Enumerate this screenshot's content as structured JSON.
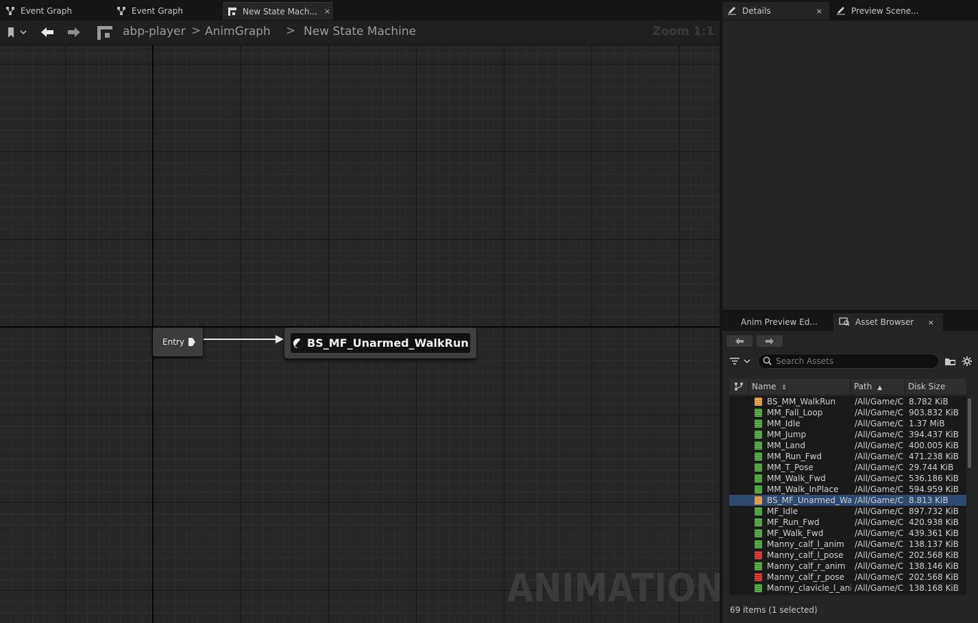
{
  "doc_tabs": [
    {
      "label": "Event Graph",
      "icon": "graph-icon"
    },
    {
      "label": "Event Graph",
      "icon": "graph-icon"
    },
    {
      "label": "New State Mach...",
      "icon": "state-machine-icon",
      "active": true,
      "close": "×"
    }
  ],
  "toolbar": {
    "breadcrumb": [
      "abp-player",
      "AnimGraph",
      "New State Machine"
    ],
    "separators": [
      ">",
      ">"
    ],
    "zoom": "Zoom 1:1"
  },
  "graph": {
    "entry_label": "Entry",
    "state_label": "BS_MF_Unarmed_WalkRun",
    "watermark": "ANIMATION"
  },
  "right_tabs": {
    "details": "Details",
    "details_close": "×",
    "preview_scene": "Preview Scene...",
    "anim_preview": "Anim Preview Ed...",
    "asset_browser": "Asset Browser",
    "asset_browser_close": "×"
  },
  "asset_browser": {
    "search_placeholder": "Search Assets",
    "columns": {
      "name": "Name",
      "path": "Path",
      "size": "Disk Size"
    },
    "rows": [
      {
        "name": "BS_MM_WalkRun",
        "path": "/All/Game/C",
        "size": "8.782 KiB",
        "type": "orange"
      },
      {
        "name": "MM_Fall_Loop",
        "path": "/All/Game/C",
        "size": "903.832 KiB",
        "type": "green"
      },
      {
        "name": "MM_Idle",
        "path": "/All/Game/C",
        "size": "1.37 MiB",
        "type": "green"
      },
      {
        "name": "MM_Jump",
        "path": "/All/Game/C",
        "size": "394.437 KiB",
        "type": "green"
      },
      {
        "name": "MM_Land",
        "path": "/All/Game/C",
        "size": "400.005 KiB",
        "type": "green"
      },
      {
        "name": "MM_Run_Fwd",
        "path": "/All/Game/C",
        "size": "471.238 KiB",
        "type": "green"
      },
      {
        "name": "MM_T_Pose",
        "path": "/All/Game/C",
        "size": "29.744 KiB",
        "type": "green"
      },
      {
        "name": "MM_Walk_Fwd",
        "path": "/All/Game/C",
        "size": "536.186 KiB",
        "type": "green"
      },
      {
        "name": "MM_Walk_InPlace",
        "path": "/All/Game/C",
        "size": "594.959 KiB",
        "type": "green"
      },
      {
        "name": "BS_MF_Unarmed_Wa",
        "path": "/All/Game/C",
        "size": "8.813 KiB",
        "type": "orange",
        "selected": true
      },
      {
        "name": "MF_Idle",
        "path": "/All/Game/C",
        "size": "897.732 KiB",
        "type": "green"
      },
      {
        "name": "MF_Run_Fwd",
        "path": "/All/Game/C",
        "size": "420.938 KiB",
        "type": "green"
      },
      {
        "name": "MF_Walk_Fwd",
        "path": "/All/Game/C",
        "size": "439.361 KiB",
        "type": "green"
      },
      {
        "name": "Manny_calf_l_anim",
        "path": "/All/Game/C",
        "size": "138.137 KiB",
        "type": "green"
      },
      {
        "name": "Manny_calf_l_pose",
        "path": "/All/Game/C",
        "size": "202.568 KiB",
        "type": "red"
      },
      {
        "name": "Manny_calf_r_anim",
        "path": "/All/Game/C",
        "size": "138.146 KiB",
        "type": "green"
      },
      {
        "name": "Manny_calf_r_pose",
        "path": "/All/Game/C",
        "size": "202.568 KiB",
        "type": "red"
      },
      {
        "name": "Manny_clavicle_l_anii",
        "path": "/All/Game/C",
        "size": "138.168 KiB",
        "type": "green"
      }
    ],
    "status": "69 items (1 selected)"
  }
}
